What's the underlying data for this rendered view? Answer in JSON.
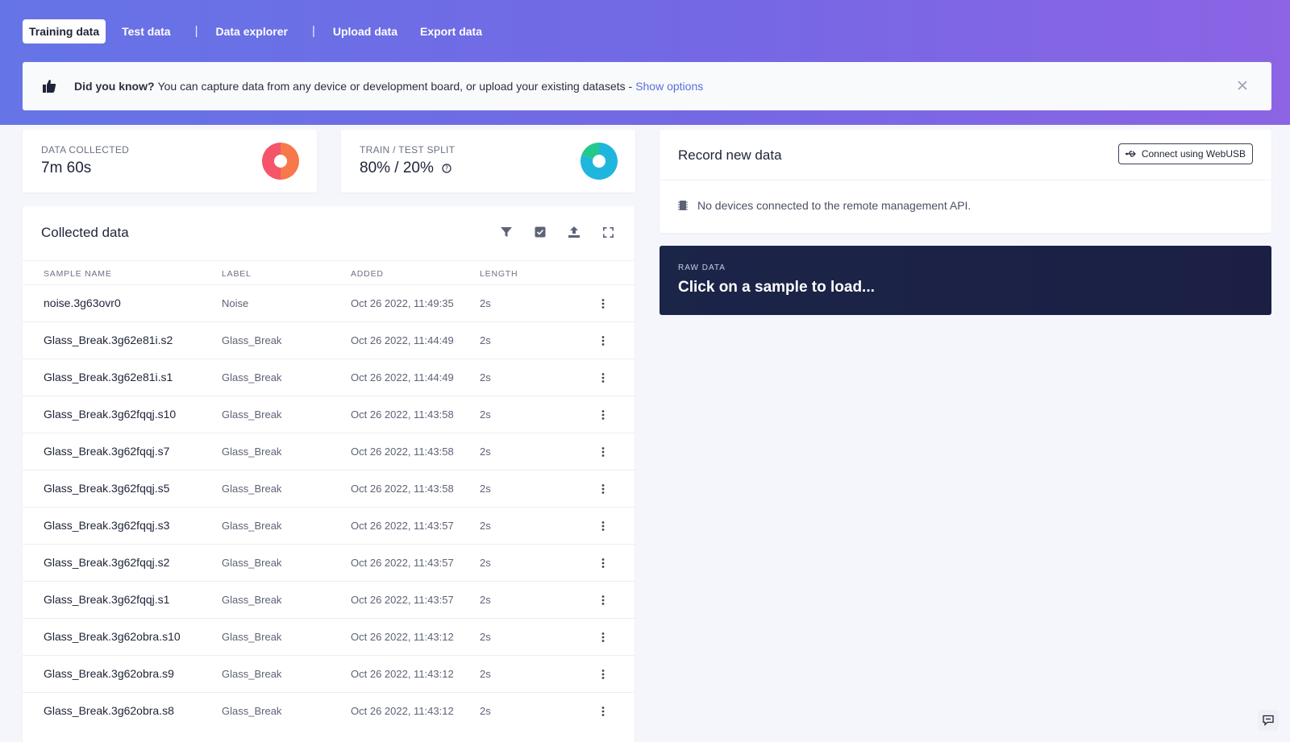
{
  "nav": {
    "tabs": [
      "Training data",
      "Test data",
      "Data explorer",
      "Upload data",
      "Export data"
    ],
    "separator": "|"
  },
  "banner": {
    "bold": "Did you know?",
    "text": "You can capture data from any device or development board, or upload your existing datasets -",
    "link": "Show options",
    "icon": "thumbs-up-icon",
    "close_icon": "close-icon"
  },
  "stats": {
    "collected": {
      "label": "DATA COLLECTED",
      "value": "7m 60s"
    },
    "split": {
      "label": "TRAIN / TEST SPLIT",
      "value": "80% / 20%",
      "train_fraction": 0.8
    }
  },
  "collected_panel": {
    "title": "Collected data",
    "tools": [
      "filter-icon",
      "checkbox-icon",
      "upload-icon",
      "fullscreen-icon"
    ],
    "columns": [
      "SAMPLE NAME",
      "LABEL",
      "ADDED",
      "LENGTH"
    ],
    "rows": [
      {
        "name": "noise.3g63ovr0",
        "label": "Noise",
        "added": "Oct 26 2022, 11:49:35",
        "length": "2s"
      },
      {
        "name": "Glass_Break.3g62e81i.s2",
        "label": "Glass_Break",
        "added": "Oct 26 2022, 11:44:49",
        "length": "2s"
      },
      {
        "name": "Glass_Break.3g62e81i.s1",
        "label": "Glass_Break",
        "added": "Oct 26 2022, 11:44:49",
        "length": "2s"
      },
      {
        "name": "Glass_Break.3g62fqqj.s10",
        "label": "Glass_Break",
        "added": "Oct 26 2022, 11:43:58",
        "length": "2s"
      },
      {
        "name": "Glass_Break.3g62fqqj.s7",
        "label": "Glass_Break",
        "added": "Oct 26 2022, 11:43:58",
        "length": "2s"
      },
      {
        "name": "Glass_Break.3g62fqqj.s5",
        "label": "Glass_Break",
        "added": "Oct 26 2022, 11:43:58",
        "length": "2s"
      },
      {
        "name": "Glass_Break.3g62fqqj.s3",
        "label": "Glass_Break",
        "added": "Oct 26 2022, 11:43:57",
        "length": "2s"
      },
      {
        "name": "Glass_Break.3g62fqqj.s2",
        "label": "Glass_Break",
        "added": "Oct 26 2022, 11:43:57",
        "length": "2s"
      },
      {
        "name": "Glass_Break.3g62fqqj.s1",
        "label": "Glass_Break",
        "added": "Oct 26 2022, 11:43:57",
        "length": "2s"
      },
      {
        "name": "Glass_Break.3g62obra.s10",
        "label": "Glass_Break",
        "added": "Oct 26 2022, 11:43:12",
        "length": "2s"
      },
      {
        "name": "Glass_Break.3g62obra.s9",
        "label": "Glass_Break",
        "added": "Oct 26 2022, 11:43:12",
        "length": "2s"
      },
      {
        "name": "Glass_Break.3g62obra.s8",
        "label": "Glass_Break",
        "added": "Oct 26 2022, 11:43:12",
        "length": "2s"
      }
    ]
  },
  "record": {
    "title": "Record new data",
    "button": "Connect using WebUSB",
    "message": "No devices connected to the remote management API."
  },
  "raw": {
    "label": "RAW DATA",
    "text": "Click on a sample to load..."
  },
  "colors": {
    "accent": "#5b6fd8",
    "donut_collected_a": "#f5546a",
    "donut_collected_b": "#f7784a",
    "donut_split_train": "#22c98a",
    "donut_split_test": "#1fb6dd",
    "raw_bg": "#1b2548"
  }
}
